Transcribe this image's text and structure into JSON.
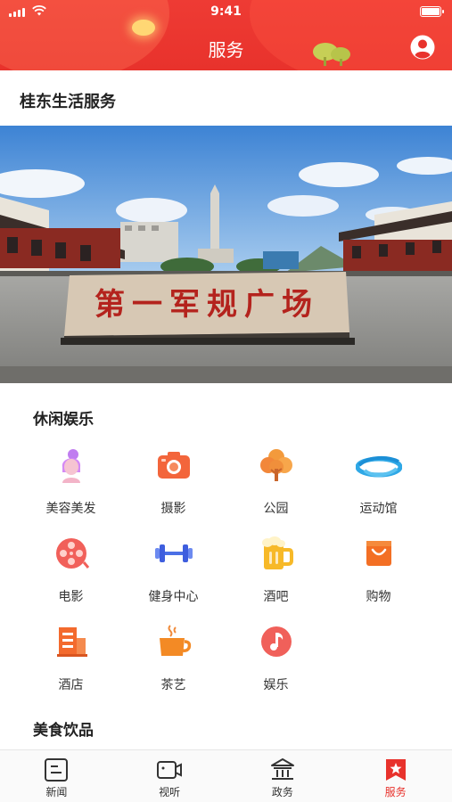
{
  "status_bar": {
    "time": "9:41"
  },
  "header": {
    "title": "服务"
  },
  "section": {
    "title": "桂东生活服务"
  },
  "banner": {
    "plaque_text": "第一军规广场"
  },
  "categories": [
    {
      "title": "休闲娱乐",
      "items": [
        {
          "label": "美容美发",
          "icon": "beauty-icon"
        },
        {
          "label": "摄影",
          "icon": "camera-icon"
        },
        {
          "label": "公园",
          "icon": "park-tree-icon"
        },
        {
          "label": "运动馆",
          "icon": "stadium-icon"
        },
        {
          "label": "电影",
          "icon": "film-reel-icon"
        },
        {
          "label": "健身中心",
          "icon": "dumbbell-icon"
        },
        {
          "label": "酒吧",
          "icon": "beer-icon"
        },
        {
          "label": "购物",
          "icon": "shopping-bag-icon"
        },
        {
          "label": "酒店",
          "icon": "hotel-building-icon"
        },
        {
          "label": "茶艺",
          "icon": "tea-cup-icon"
        },
        {
          "label": "娱乐",
          "icon": "music-note-icon"
        }
      ]
    },
    {
      "title": "美食饮品",
      "items": []
    }
  ],
  "tabbar": {
    "items": [
      {
        "label": "新闻",
        "icon": "news-icon",
        "active": false
      },
      {
        "label": "视听",
        "icon": "video-camera-icon",
        "active": false
      },
      {
        "label": "政务",
        "icon": "government-building-icon",
        "active": false
      },
      {
        "label": "服务",
        "icon": "service-star-icon",
        "active": true
      }
    ]
  },
  "colors": {
    "brand_red": "#e8322c",
    "icon_orange": "#f7663a"
  }
}
